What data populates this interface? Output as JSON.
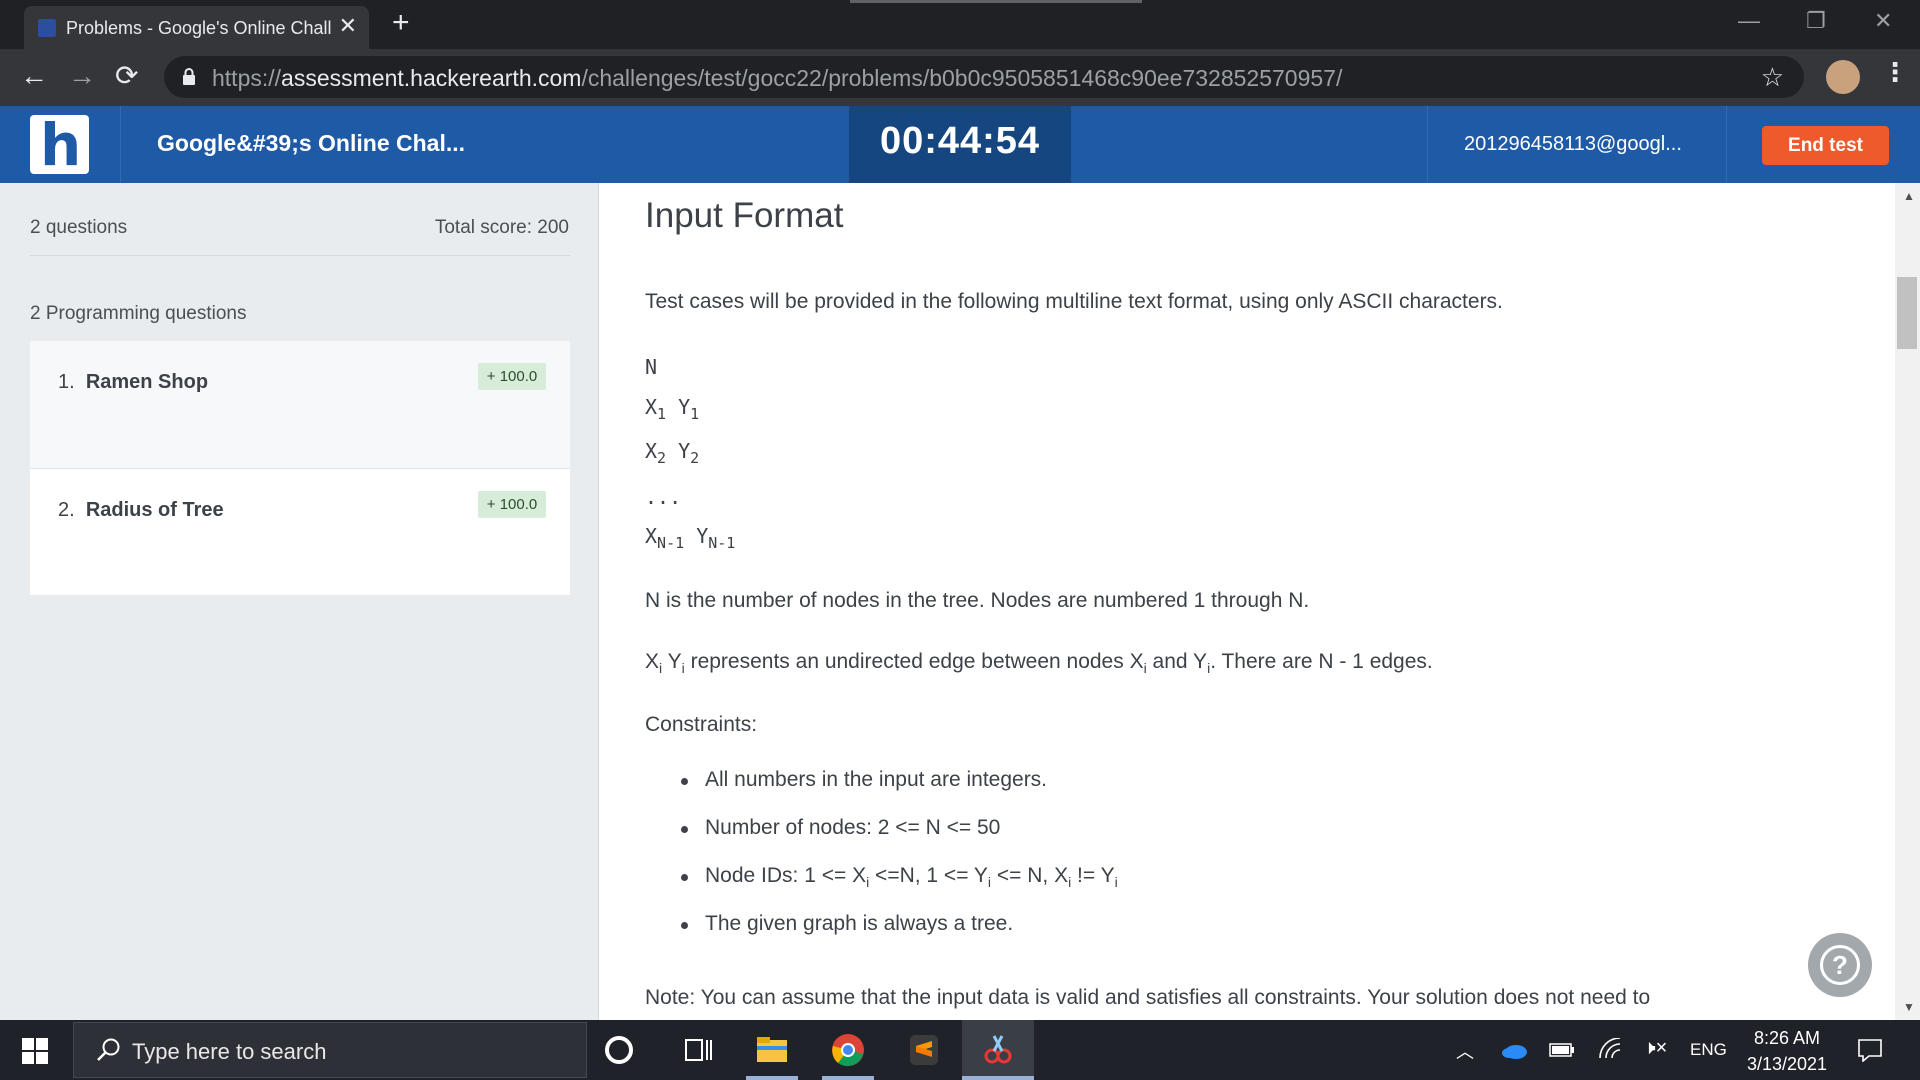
{
  "browser": {
    "tab_title": "Problems - Google's Online Chall",
    "tab_close": "✕",
    "new_tab": "+",
    "url_scheme": "https://",
    "url_host": "assessment.hackerearth.com",
    "url_path": "/challenges/test/gocc22/problems/b0b0c9505851468c90ee732852570957/"
  },
  "header": {
    "logo_letter": "h",
    "title": "Google&#39;s Online Chal...",
    "timer": "00:44:54",
    "user": "201296458113@googl...",
    "end_button": "End test"
  },
  "sidebar": {
    "question_count": "2 questions",
    "total_score": "Total score: 200",
    "section_title": "2 Programming questions",
    "questions": [
      {
        "number": "1.",
        "title": "Ramen Shop",
        "score": "+ 100.0"
      },
      {
        "number": "2.",
        "title": "Radius of Tree",
        "score": "+ 100.0"
      }
    ]
  },
  "problem": {
    "heading": "Input Format",
    "intro": "Test cases will be provided in the following multiline text format, using only ASCII characters.",
    "format_lines": {
      "n": "N",
      "x": "X",
      "y": "Y",
      "sub1": "1",
      "sub2": "2",
      "dots": "...",
      "subn": "N-1"
    },
    "nodes_desc": "N is the number of nodes in the tree. Nodes are numbered 1 through N.",
    "edge_desc": {
      "x": "X",
      "y": "Y",
      "i": "i",
      "middle": " represents an undirected edge between nodes ",
      "and": " and ",
      "end": ". There are N - 1 edges."
    },
    "constraints_label": "Constraints:",
    "constraints": {
      "c1": "All numbers in the input are integers.",
      "c2": "Number of nodes: 2 <= N <= 50",
      "c3_a": "Node IDs: 1 <= X",
      "c3_b": " <=N, 1 <= Y",
      "c3_c": " <= N, X",
      "c3_d": " != Y",
      "c4": "The given graph is always a tree."
    },
    "note": "Note: You can assume that the input data is valid and satisfies all constraints. Your solution does not need to"
  },
  "help": {
    "label": "?"
  },
  "taskbar": {
    "search_placeholder": "Type here to search",
    "language": "ENG",
    "time": "8:26 AM",
    "date": "3/13/2021"
  },
  "colors": {
    "header_blue": "#1f5aa6",
    "timer_blue": "#16467f",
    "end_test_orange": "#ee5a2b",
    "score_badge_green": "#d7ecd9"
  }
}
